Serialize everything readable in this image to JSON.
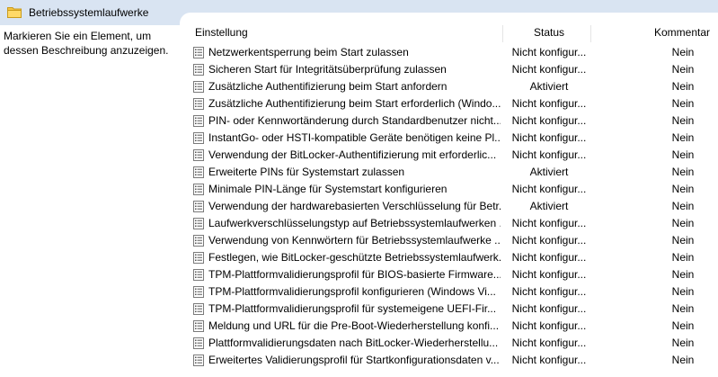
{
  "window": {
    "title": "Betriebssystemlaufwerke",
    "folder_icon": "folder-icon"
  },
  "left_panel": {
    "description": "Markieren Sie ein Element, um dessen Beschreibung anzuzeigen."
  },
  "table": {
    "headers": {
      "setting": "Einstellung",
      "status": "Status",
      "comment": "Kommentar"
    },
    "row_icon": "policy-setting-icon",
    "rows": [
      {
        "name": "Netzwerkentsperrung beim Start zulassen",
        "status": "Nicht konfigur...",
        "comment": "Nein"
      },
      {
        "name": "Sicheren Start für Integritätsüberprüfung zulassen",
        "status": "Nicht konfigur...",
        "comment": "Nein"
      },
      {
        "name": "Zusätzliche Authentifizierung beim Start anfordern",
        "status": "Aktiviert",
        "comment": "Nein"
      },
      {
        "name": "Zusätzliche Authentifizierung beim Start erforderlich (Windo...",
        "status": "Nicht konfigur...",
        "comment": "Nein"
      },
      {
        "name": "PIN- oder Kennwortänderung durch Standardbenutzer nicht...",
        "status": "Nicht konfigur...",
        "comment": "Nein"
      },
      {
        "name": "InstantGo- oder HSTI-kompatible Geräte benötigen keine Pl...",
        "status": "Nicht konfigur...",
        "comment": "Nein"
      },
      {
        "name": "Verwendung der BitLocker-Authentifizierung mit erforderlic...",
        "status": "Nicht konfigur...",
        "comment": "Nein"
      },
      {
        "name": "Erweiterte PINs für Systemstart zulassen",
        "status": "Aktiviert",
        "comment": "Nein"
      },
      {
        "name": "Minimale PIN-Länge für Systemstart konfigurieren",
        "status": "Nicht konfigur...",
        "comment": "Nein"
      },
      {
        "name": "Verwendung der hardwarebasierten Verschlüsselung für Betr...",
        "status": "Aktiviert",
        "comment": "Nein"
      },
      {
        "name": "Laufwerkverschlüsselungstyp auf Betriebssystemlaufwerken ...",
        "status": "Nicht konfigur...",
        "comment": "Nein"
      },
      {
        "name": "Verwendung von Kennwörtern für Betriebssystemlaufwerke ...",
        "status": "Nicht konfigur...",
        "comment": "Nein"
      },
      {
        "name": "Festlegen, wie BitLocker-geschützte Betriebssystemlaufwerk...",
        "status": "Nicht konfigur...",
        "comment": "Nein"
      },
      {
        "name": "TPM-Plattformvalidierungsprofil für BIOS-basierte Firmware...",
        "status": "Nicht konfigur...",
        "comment": "Nein"
      },
      {
        "name": "TPM-Plattformvalidierungsprofil konfigurieren (Windows Vi...",
        "status": "Nicht konfigur...",
        "comment": "Nein"
      },
      {
        "name": "TPM-Plattformvalidierungsprofil für systemeigene UEFI-Fir...",
        "status": "Nicht konfigur...",
        "comment": "Nein"
      },
      {
        "name": "Meldung und URL für die Pre-Boot-Wiederherstellung konfi...",
        "status": "Nicht konfigur...",
        "comment": "Nein"
      },
      {
        "name": "Plattformvalidierungsdaten nach BitLocker-Wiederherstellu...",
        "status": "Nicht konfigur...",
        "comment": "Nein"
      },
      {
        "name": "Erweitertes Validierungsprofil für Startkonfigurationsdaten v...",
        "status": "Nicht konfigur...",
        "comment": "Nein"
      }
    ]
  }
}
